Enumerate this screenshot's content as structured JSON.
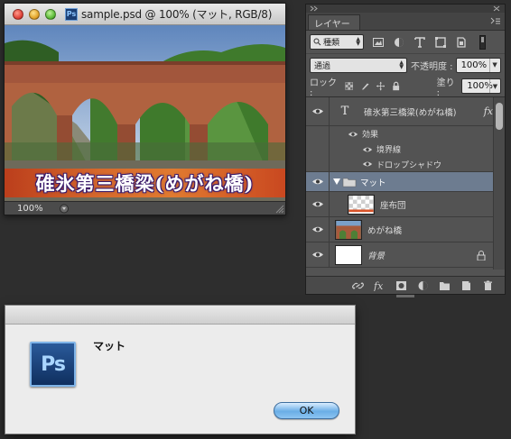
{
  "document": {
    "title": "sample.psd @ 100% (マット, RGB/8)",
    "ps_badge": "Ps",
    "caption": "碓氷第三橋梁(めがね橋)",
    "zoom": "100%"
  },
  "layers_panel": {
    "tab_label": "レイヤー",
    "filter_kind": "種類",
    "blend_mode": "通過",
    "opacity_label": "不透明度 :",
    "opacity_value": "100%",
    "lock_label": "ロック :",
    "fill_label": "塗り :",
    "fill_value": "100%",
    "layers": {
      "text_layer": "碓氷第三橋梁(めがね橋)",
      "effects_label": "効果",
      "effect_stroke": "境界線",
      "effect_shadow": "ドロップシャドウ",
      "group": "マット",
      "pattern_layer": "座布団",
      "photo_layer": "めがね橋",
      "background_layer": "背景"
    },
    "fx_badge": "fx",
    "text_layer_icon": "T"
  },
  "alert": {
    "app_badge": "Ps",
    "message": "マット",
    "ok_label": "OK"
  },
  "colors": {
    "selected_layer": "#6d7c90",
    "panel_bg": "#535353",
    "desktop_bg": "#2e2e2e"
  }
}
